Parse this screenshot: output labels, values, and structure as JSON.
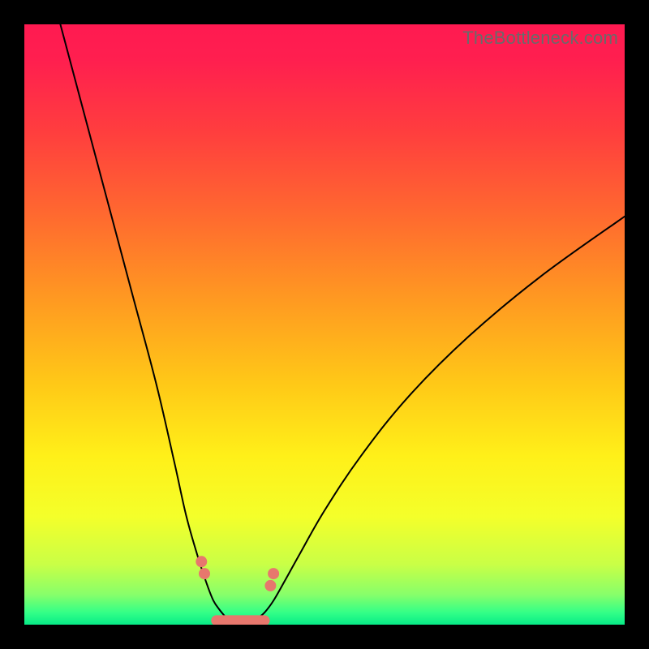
{
  "watermark": "TheBottleneck.com",
  "colors": {
    "gradient_stops": [
      {
        "offset": 0.0,
        "color": "#ff1a51"
      },
      {
        "offset": 0.06,
        "color": "#ff1f4f"
      },
      {
        "offset": 0.18,
        "color": "#ff3e3e"
      },
      {
        "offset": 0.32,
        "color": "#ff6a2f"
      },
      {
        "offset": 0.46,
        "color": "#ff9a21"
      },
      {
        "offset": 0.6,
        "color": "#ffc917"
      },
      {
        "offset": 0.72,
        "color": "#fff019"
      },
      {
        "offset": 0.82,
        "color": "#f4ff2a"
      },
      {
        "offset": 0.9,
        "color": "#c9ff46"
      },
      {
        "offset": 0.95,
        "color": "#87ff6a"
      },
      {
        "offset": 0.98,
        "color": "#33ff87"
      },
      {
        "offset": 1.0,
        "color": "#07eb87"
      }
    ],
    "curve": "#000000",
    "markers": "#e7776d",
    "frame": "#000000"
  },
  "chart_data": {
    "type": "line",
    "title": "",
    "xlabel": "",
    "ylabel": "",
    "xlim": [
      0,
      100
    ],
    "ylim": [
      0,
      100
    ],
    "grid": false,
    "note": "Double-branch V-shaped curve; axes are relative percentages (no tick labels shown). Values estimated from pixel positions.",
    "series": [
      {
        "name": "left-branch",
        "x": [
          6,
          10,
          14,
          18,
          22,
          25,
          27,
          29,
          30.5,
          31.5,
          32.5,
          33.5
        ],
        "y": [
          100,
          85,
          70,
          55,
          40,
          27,
          18,
          11,
          6.5,
          4.0,
          2.5,
          1.3
        ]
      },
      {
        "name": "right-branch",
        "x": [
          39,
          40,
          41.5,
          43.5,
          46,
          50,
          56,
          64,
          74,
          86,
          100
        ],
        "y": [
          1.2,
          2.0,
          4.0,
          7.5,
          12,
          19,
          28,
          38,
          48,
          58,
          68
        ]
      },
      {
        "name": "valley-floor",
        "x": [
          33.5,
          34.5,
          35.5,
          36.5,
          37.5,
          38.5,
          39
        ],
        "y": [
          1.3,
          0.6,
          0.3,
          0.25,
          0.3,
          0.7,
          1.2
        ]
      }
    ],
    "markers": {
      "name": "highlighted-points",
      "note": "Salmon markers/segments near valley floor and lower slopes",
      "points": [
        {
          "x": 29.5,
          "y": 10.5
        },
        {
          "x": 30.0,
          "y": 8.5
        },
        {
          "x": 41.0,
          "y": 6.5
        },
        {
          "x": 41.5,
          "y": 8.5
        }
      ],
      "floor_segment": {
        "x0": 32.0,
        "x1": 40.0,
        "y": 0.7
      }
    }
  }
}
